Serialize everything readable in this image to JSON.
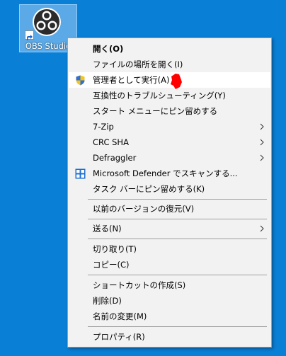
{
  "desktop_icon": {
    "label": "OBS Studio",
    "icon": "obs-studio-icon"
  },
  "menu": {
    "items": [
      {
        "label": "開く(O)",
        "bold": true
      },
      {
        "label": "ファイルの場所を開く(I)"
      },
      {
        "label": "管理者として実行(A)",
        "icon": "uac-shield-icon",
        "highlighted": true
      },
      {
        "label": "互換性のトラブルシューティング(Y)"
      },
      {
        "label": "スタート メニューにピン留めする"
      },
      {
        "label": "7-Zip",
        "submenu": true
      },
      {
        "label": "CRC SHA",
        "submenu": true
      },
      {
        "label": "Defraggler",
        "submenu": true
      },
      {
        "label": "Microsoft Defender でスキャンする...",
        "icon": "defender-icon"
      },
      {
        "label": "タスク バーにピン留めする(K)"
      },
      {
        "label": "以前のバージョンの復元(V)"
      },
      {
        "label": "送る(N)",
        "submenu": true
      },
      {
        "label": "切り取り(T)"
      },
      {
        "label": "コピー(C)"
      },
      {
        "label": "ショートカットの作成(S)"
      },
      {
        "label": "削除(D)"
      },
      {
        "label": "名前の変更(M)"
      },
      {
        "label": "プロパティ(R)"
      }
    ]
  },
  "colors": {
    "desktop": "#0a7fd6",
    "menu_bg": "#f2f2f2",
    "highlight": "#ffffff",
    "annotation": "#ff0000"
  }
}
